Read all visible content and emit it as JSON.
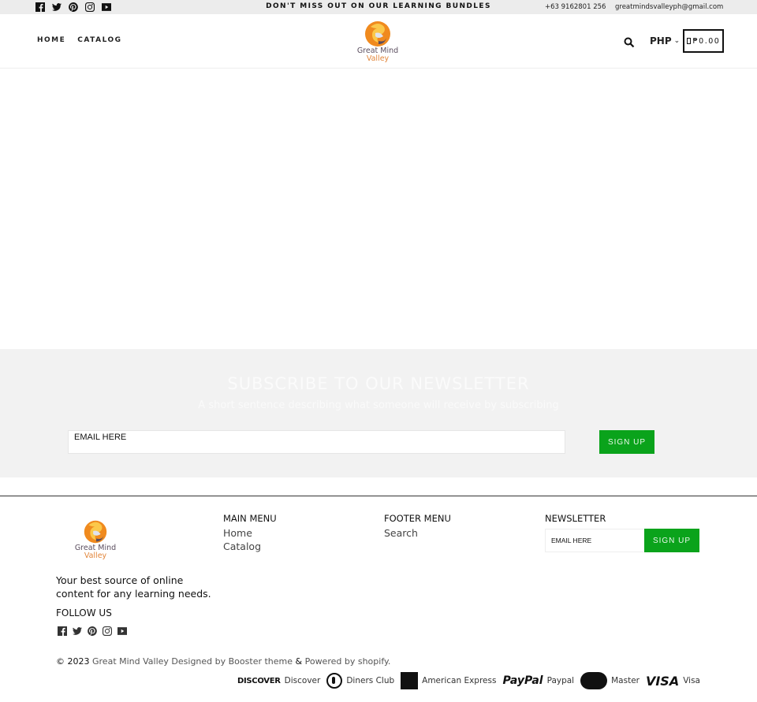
{
  "topbar": {
    "social_icons": [
      "facebook-icon",
      "twitter-icon",
      "pinterest-icon",
      "instagram-icon",
      "youtube-icon"
    ],
    "announcement": "DON'T MISS OUT ON OUR LEARNING BUNDLES",
    "phone": "+63 9162801 256",
    "email": "greatmindsvalleyph@gmail.com"
  },
  "header": {
    "nav": [
      "HOME",
      "CATALOG"
    ],
    "logo": {
      "line1": "Great Mind",
      "line2": "Valley"
    },
    "currency": "PHP",
    "cart_total": "₱0.00"
  },
  "newsletter": {
    "title": "SUBSCRIBE TO OUR NEWSLETTER",
    "subtitle": "A short sentence describing what someone will receive by subscribing",
    "email_placeholder": "EMAIL HERE",
    "button": "SIGN UP"
  },
  "footer": {
    "logo": {
      "line1": "Great Mind",
      "line2": "Valley"
    },
    "tagline": "Your best source of online content for any learning needs.",
    "follow_us": "FOLLOW US",
    "main_menu": {
      "title": "MAIN MENU",
      "links": [
        "Home",
        "Catalog"
      ]
    },
    "footer_menu": {
      "title": "FOOTER MENU",
      "links": [
        "Search"
      ]
    },
    "newsletter": {
      "title": "NEWSLETTER",
      "email_placeholder": "EMAIL HERE",
      "button": "SIGN UP"
    },
    "copyright": {
      "prefix": "© 2023",
      "store": "Great Mind Valley",
      "designed": "Designed by",
      "theme": "Booster theme",
      "amp": "&",
      "powered": "Powered by shopify."
    },
    "payments": [
      {
        "logo": "DISCOVER",
        "label": "Discover"
      },
      {
        "logo": "",
        "label": "Diners Club"
      },
      {
        "logo": "",
        "label": "American Express"
      },
      {
        "logo": "PayPal",
        "label": "Paypal"
      },
      {
        "logo": "",
        "label": "Master"
      },
      {
        "logo": "VISA",
        "label": "Visa"
      }
    ]
  },
  "colors": {
    "accent_green": "#0aa31b",
    "topbar_bg": "#ececec",
    "newsletter_bg": "#f2f2f2",
    "logo_orange": "#e2863b"
  }
}
